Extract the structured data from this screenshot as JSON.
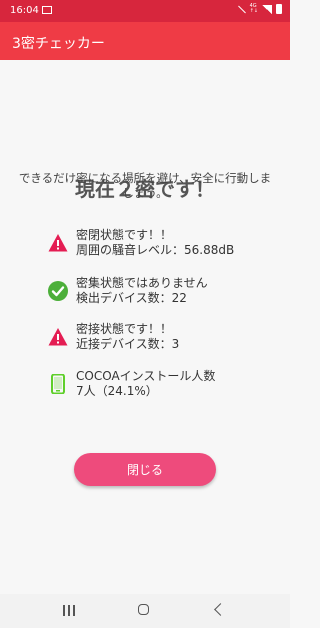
{
  "status_bar": {
    "time": "16:04",
    "icons": [
      "image-icon",
      "mute-icon",
      "network-4g-icon",
      "signal-icon",
      "battery-icon"
    ]
  },
  "app_bar": {
    "title": "3密チェッカー"
  },
  "main": {
    "heading": "現在２密です！",
    "subtext": "できるだけ密になる場所を避け、安全に行動しましょう。",
    "items": [
      {
        "icon": "warning-triangle-icon",
        "line1": "密閉状態です！！",
        "line2": "周囲の騒音レベル：56.88dB",
        "color": "#e41d53"
      },
      {
        "icon": "check-circle-icon",
        "line1": "密集状態ではありません",
        "line2": "検出デバイス数：22",
        "color": "#4caf3a"
      },
      {
        "icon": "warning-triangle-icon",
        "line1": "密接状態です！！",
        "line2": "近接デバイス数：3",
        "color": "#e41d53"
      },
      {
        "icon": "phone-icon",
        "line1": "COCOAインストール人数",
        "line2": "7人（24.1%）",
        "color": "#5fcf2b"
      }
    ],
    "close_button": "閉じる"
  },
  "colors": {
    "status_bar": "#d7263d",
    "app_bar": "#ef3b45",
    "button": "#ee4b7c"
  }
}
